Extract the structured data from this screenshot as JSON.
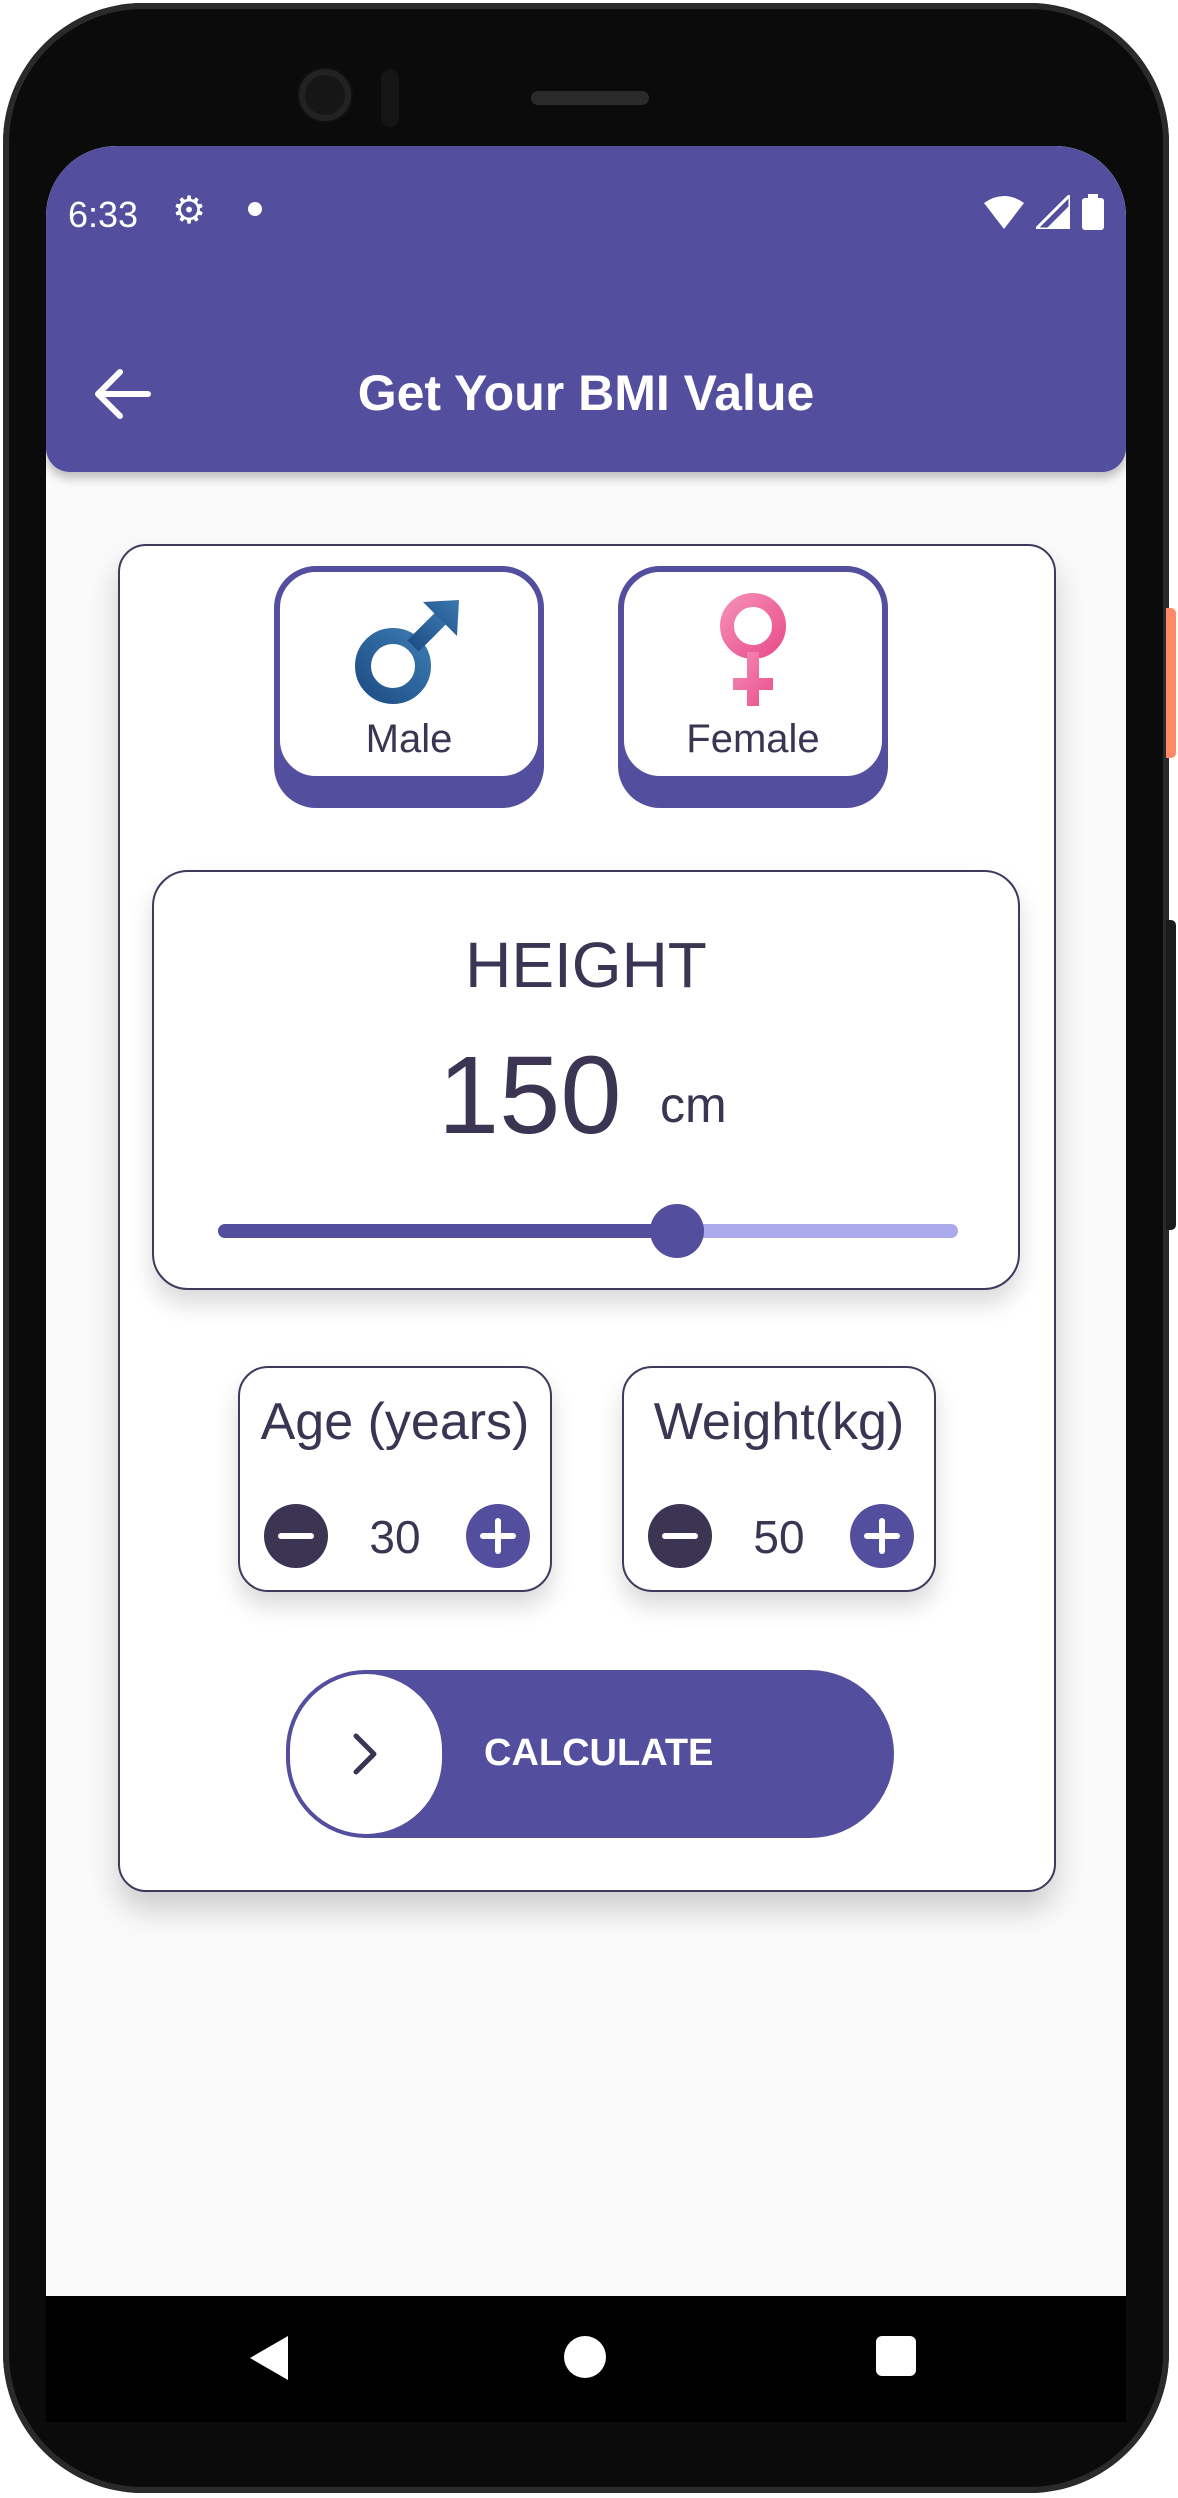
{
  "status_bar": {
    "time": "6:33",
    "icons": [
      "gear-icon",
      "notification-dot",
      "wifi-icon",
      "signal-icon",
      "battery-icon"
    ]
  },
  "app_bar": {
    "title": "Get Your BMI Value",
    "back_icon": "arrow-left-icon"
  },
  "gender": {
    "male": {
      "label": "Male",
      "icon": "male-symbol-icon"
    },
    "female": {
      "label": "Female",
      "icon": "female-symbol-icon"
    }
  },
  "height": {
    "title": "HEIGHT",
    "value": "150",
    "unit": "cm",
    "slider_fraction": 0.62
  },
  "age": {
    "title": "Age (years)",
    "value": "30"
  },
  "weight": {
    "title": "Weight(kg)",
    "value": "50"
  },
  "calculate": {
    "label": "CALCULATE",
    "icon": "chevron-right-icon"
  },
  "nav_bar": {
    "icons": [
      "nav-back-icon",
      "nav-home-icon",
      "nav-recents-icon"
    ]
  },
  "colors": {
    "primary": "#534f9e",
    "text": "#3b3553",
    "track": "#aba8ec",
    "male_blue": "#2d5d8f",
    "female_pink": "#f06ba0"
  }
}
